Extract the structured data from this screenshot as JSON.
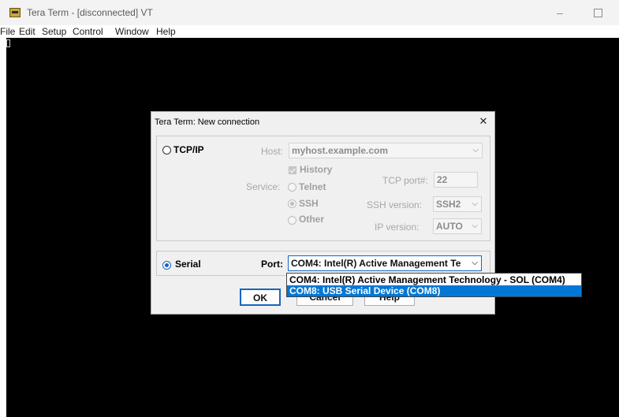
{
  "window": {
    "title": "Tera Term - [disconnected] VT",
    "minimize": "–"
  },
  "menu": [
    "File",
    "Edit",
    "Setup",
    "Control",
    "Window",
    "Help"
  ],
  "dialog": {
    "title": "Tera Term: New connection",
    "close": "✕",
    "tcpip": {
      "label": "TCP/IP",
      "host_label": "Host:",
      "host_value": "myhost.example.com",
      "history_label": "History",
      "service_label": "Service:",
      "telnet_label": "Telnet",
      "ssh_label": "SSH",
      "other_label": "Other",
      "tcp_port_label": "TCP port#:",
      "tcp_port_value": "22",
      "ssh_version_label": "SSH version:",
      "ssh_version_value": "SSH2",
      "ip_version_label": "IP version:",
      "ip_version_value": "AUTO"
    },
    "serial": {
      "label": "Serial",
      "port_label": "Port:",
      "port_value": "COM4: Intel(R) Active Management Te",
      "options": [
        "COM4: Intel(R) Active Management Technology - SOL (COM4)",
        "COM8: USB Serial Device (COM8)"
      ]
    },
    "buttons": {
      "ok": "OK",
      "cancel": "Cancel",
      "help": "Help"
    }
  },
  "colors": {
    "terminal_bg": "#000000",
    "selection": "#0078d7",
    "radio_selected": "#1665c0"
  }
}
